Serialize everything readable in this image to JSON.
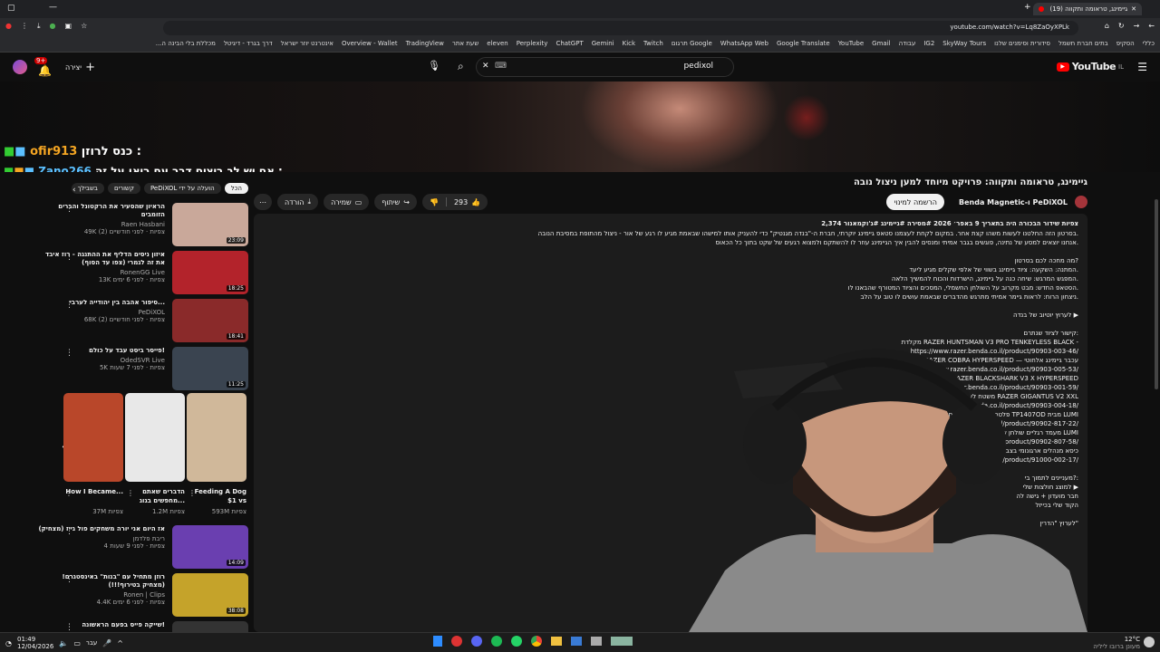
{
  "browser": {
    "tab_title": "(19) גיימינג, טראומה ותקווה",
    "url": "youtube.com/watch?v=Lq8ZaOyXPLk",
    "bookmarks": [
      "כללי",
      "הסקיפ",
      "בתים חברת חשמל",
      "סידורית וסימנים שלנו",
      "SkyWay Tours",
      "IG2",
      "עבודה",
      "Gmail",
      "YouTube",
      "Google Translate",
      "WhatsApp Web",
      "Google תרגום",
      "Twitch",
      "Kick",
      "Gemini",
      "ChatGPT",
      "Perplexity",
      "eleven",
      "שעת אתר",
      "TradingView",
      "Overview - Wallet",
      "אינטרנט יוזר ישראל",
      "דרך בגרד - דיגיטל",
      "מכללת בלי הבינה ה..."
    ]
  },
  "header": {
    "logo": "YouTube",
    "logo_sup": "IL",
    "search_value": "pedixol",
    "create_label": "יצירה",
    "notif_count": "9+"
  },
  "overlay": {
    "line1_user": "ofir913",
    "line1_text": "כנס לרוזן :",
    "line2_user": "Zano266",
    "line2_text": "אם יש לך ביצים דבר עם ריאן על זה :"
  },
  "video": {
    "title": "גיימינג, טראומה ותקווה: פרויקט מיוחד למען ניצול נובה",
    "channel": "PeDiXOL ו-Benda Magnetic",
    "subscribe_label": "הרשמה למינוי",
    "likes": "293",
    "share_label": "שיתוף",
    "save_label": "שמירה",
    "download_label": "הורדה",
    "more_icon": "more-horizontal-icon"
  },
  "description": {
    "stats": "2,374 צפיות  שידור הבכורה היה בתאריך 9 באפר׳ 2026  #מסירה #גיימינג #ג'וקמאנור",
    "lines": [
      "בסרטון הזה החלטנו לעשות משהו קצת אחר. במקום לקחת לעצמנו סטאפ גיימינג יוקרתי, חברת ה-\"בנדה מגנטיק\" כדי להעניק אותו למישהו שבאמת מגיע לו רגע של אור - ניצול מהתופת במסיבת הנובה.",
      "אנחנו יוצאים למסע של נתינה, פוגשים בגבר אמיתי ומנסים להבין איך הגיימינג עוזר לו להשתקם ולמצוא רגעים של שקט בתוך כל הכאוס.",
      "",
      "מה מחכה לכם בסרטון?",
      "המתנה: השקעה: ציוד גיימינג בשווי של אלפי שקלים מגיע ליעד.",
      "המפגש המרגש: שיחה כנה על גיימינג, הישרדות והכוח להמשיך הלאה.",
      "הסטאפ החדש: מבט מקרוב על השולחן החשמלי, המסכים והציוד המטורף שהבאנו לו.",
      "ניצחון הרוח: לראות גיימר אמיתי מתרגש מהדברים שבאמת עושים לו טוב על הלב.",
      "",
      "לערוץ יוטיוב של בנדה ▶",
      "",
      "קישור לציוד שנתרם:",
      "מקלדת RAZER HUNTSMAN V3 PRO TENKEYLESS BLACK -",
      "https://www.razer.benda.co.il/product/90903-003-46/",
      "RAZER COBRA HYPERSPEED — עכבר גיימינג אלחוטי",
      "https://www.razer.benda.co.il/product/90903-005-53/",
      "אוזניות RAZER BLACKSHARK V3 X HYPERSPEED",
      "https://www.razer.benda.co.il/product/90903-001-59/",
      "משטח לעכבר RAZER GIGANTUS V2 XXL",
      "https://www.razer.benda.co.il/product/90903-004-18/",
      "פלטת שולחן בצבע שחור דגם TP1407OD מבית LUMI",
      "https://www.benda.co.il/product/90902-817-22/",
      "מעמד רגליים שולחן שחורות לשולחן חשמלי מבית LUMI",
      "https://www.benda.co.il/product/90902-807-58/",
      "כיסא מנהלים ארגונומי בצבע שחור עם משענ",
      "https://www.benda.co.il/product/91000-002-17/",
      "",
      "מעניינים לתמוך בי?:",
      "למוצג חולצות שלי ▶",
      "חבר מועדון + גישה לה",
      "הקוד שלי בכייזל",
      "",
      "לערוץ \"הדרין\""
    ]
  },
  "sidebar": {
    "chips": [
      "הכל",
      "הועלה על ידי PeDiXOL",
      "קשורים",
      "בשבילך"
    ],
    "items": [
      {
        "title": "הראיון שהסעיר את הרקטונל והברים הזומבים",
        "channel": "Raen Hasbani",
        "stats": "49K צפיות · לפני חודשיים (2)",
        "dur": "23:09",
        "thumb": "#c9a89a"
      },
      {
        "title": "איזון ניסים הדליף את ההתנגה - רוז איבד את זה לגמרי (צפו עד הסוף)",
        "channel": "RonenGG Live",
        "stats": "13K צפיות · לפני 6 ימים",
        "dur": "18:25",
        "thumb": "#b3232b"
      },
      {
        "title": "סיפור אהבה בין יהודייה לערבי...",
        "channel": "PeDiXOL",
        "stats": "68K צפיות · לפני חודשיים (2)",
        "dur": "18:41",
        "thumb": "#8a2a2a"
      },
      {
        "title": "פייסר ביסט עבד על כולם!",
        "channel": "OdedSVR Live",
        "stats": "5K צפיות · לפני 7 שעות",
        "dur": "11:25",
        "thumb": "#3a4450"
      }
    ],
    "shorts": [
      {
        "title": "Feeding A Dog $1 vs",
        "views": "593M צפיות",
        "bg": "#d0b89a"
      },
      {
        "title": "הדברים שאתם מחפשים בגוג...",
        "views": "1.2M צפיות",
        "bg": "#e8e8e8"
      },
      {
        "title": "How I Became...",
        "views": "37M צפיות",
        "bg": "#b9472a"
      }
    ],
    "items2": [
      {
        "title": "אז היום אני יורה משחקים פול גייז (מצחיק)",
        "channel": "ריבת פלדמן",
        "stats": "4 צפיות · לפני 9 שעות",
        "dur": "14:09",
        "thumb": "#6a3fb0"
      },
      {
        "title": "רוזן מתחיל עם \"בנות\" באינסטגרם! (מצחיק בטירוף!!!)",
        "channel": "Ronen | Clips",
        "stats": "4.4K צפיות · לפני 6 ימים",
        "dur": "38:08",
        "thumb": "#c5a32a"
      },
      {
        "title": "שייקה פייס בפעם הראשונה!",
        "channel": "",
        "stats": "",
        "dur": "",
        "thumb": "#333"
      }
    ]
  },
  "taskbar": {
    "time": "01:49",
    "date": "12/04/2026",
    "lang": "עבר",
    "weather_temp": "12°C",
    "weather_desc": "מעונן ברובו ליליה"
  },
  "colors": {
    "accent": "#3ea6ff",
    "yt_red": "#ff0000",
    "overlay_user": "#f5a623",
    "overlay_user2": "#5bc0ff"
  }
}
